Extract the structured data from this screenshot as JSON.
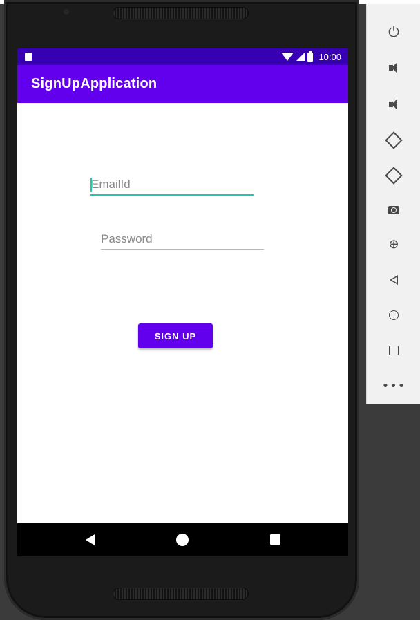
{
  "app": {
    "title": "SignUpApplication"
  },
  "status_bar": {
    "time": "10:00"
  },
  "form": {
    "email_placeholder": "EmailId",
    "password_placeholder": "Password",
    "signup_label": "SIGN UP"
  },
  "emulator_toolbar": {
    "items": [
      "power-icon",
      "volume-up-icon",
      "volume-down-icon",
      "rotate-left-icon",
      "rotate-right-icon",
      "screenshot-icon",
      "zoom-icon",
      "back-icon",
      "home-icon",
      "overview-icon",
      "more-icon"
    ]
  },
  "colors": {
    "status_bar": "#3700b3",
    "app_bar": "#6200ee",
    "accent": "#1ec8b0",
    "button": "#6200ee"
  }
}
